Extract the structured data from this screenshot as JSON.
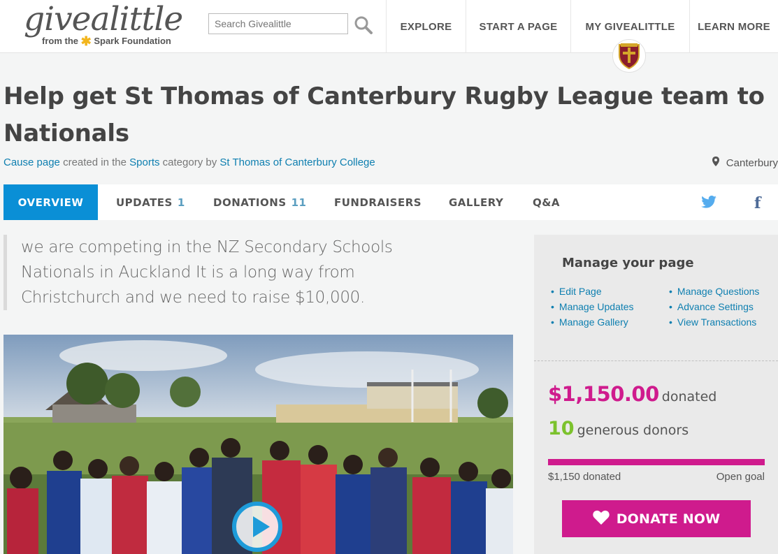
{
  "header": {
    "logo_main": "givealittle",
    "logo_sub_prefix": "from the",
    "logo_sub_suffix": "Spark Foundation",
    "search_placeholder": "Search Givealittle",
    "nav": [
      "EXPLORE",
      "START A PAGE",
      "MY GIVEALITTLE",
      "LEARN MORE"
    ]
  },
  "page": {
    "title": "Help get St Thomas of Canterbury Rugby League team to Nationals",
    "meta": {
      "type_link": "Cause page",
      "created_in": " created in the ",
      "category_link": "Sports",
      "category_by": " category by ",
      "owner_link": "St Thomas of Canterbury College"
    },
    "location": "Canterbury"
  },
  "tabs": [
    {
      "label": "OVERVIEW",
      "count": ""
    },
    {
      "label": "UPDATES",
      "count": "1"
    },
    {
      "label": "DONATIONS",
      "count": "11"
    },
    {
      "label": "FUNDRAISERS",
      "count": ""
    },
    {
      "label": "GALLERY",
      "count": ""
    },
    {
      "label": "Q&A",
      "count": ""
    }
  ],
  "summary": "we are competing in the NZ Secondary Schools Nationals in Auckland It is a long way from Christchurch and we need to raise $10,000.",
  "manage": {
    "title": "Manage your page",
    "left": [
      "Edit Page",
      "Manage Updates",
      "Manage Gallery"
    ],
    "right": [
      "Manage Questions",
      "Advance Settings",
      "View Transactions"
    ]
  },
  "stats": {
    "amount": "$1,150.00",
    "amount_label": "donated",
    "donors": "10",
    "donors_label": "generous donors",
    "progress_fraction": 1.0,
    "progress_left": "$1,150 donated",
    "progress_right": "Open goal",
    "donate_label": "DONATE NOW"
  },
  "colors": {
    "accent_pink": "#cf1b8d",
    "accent_blue": "#0a8fd6",
    "donor_green": "#7cc22d"
  }
}
